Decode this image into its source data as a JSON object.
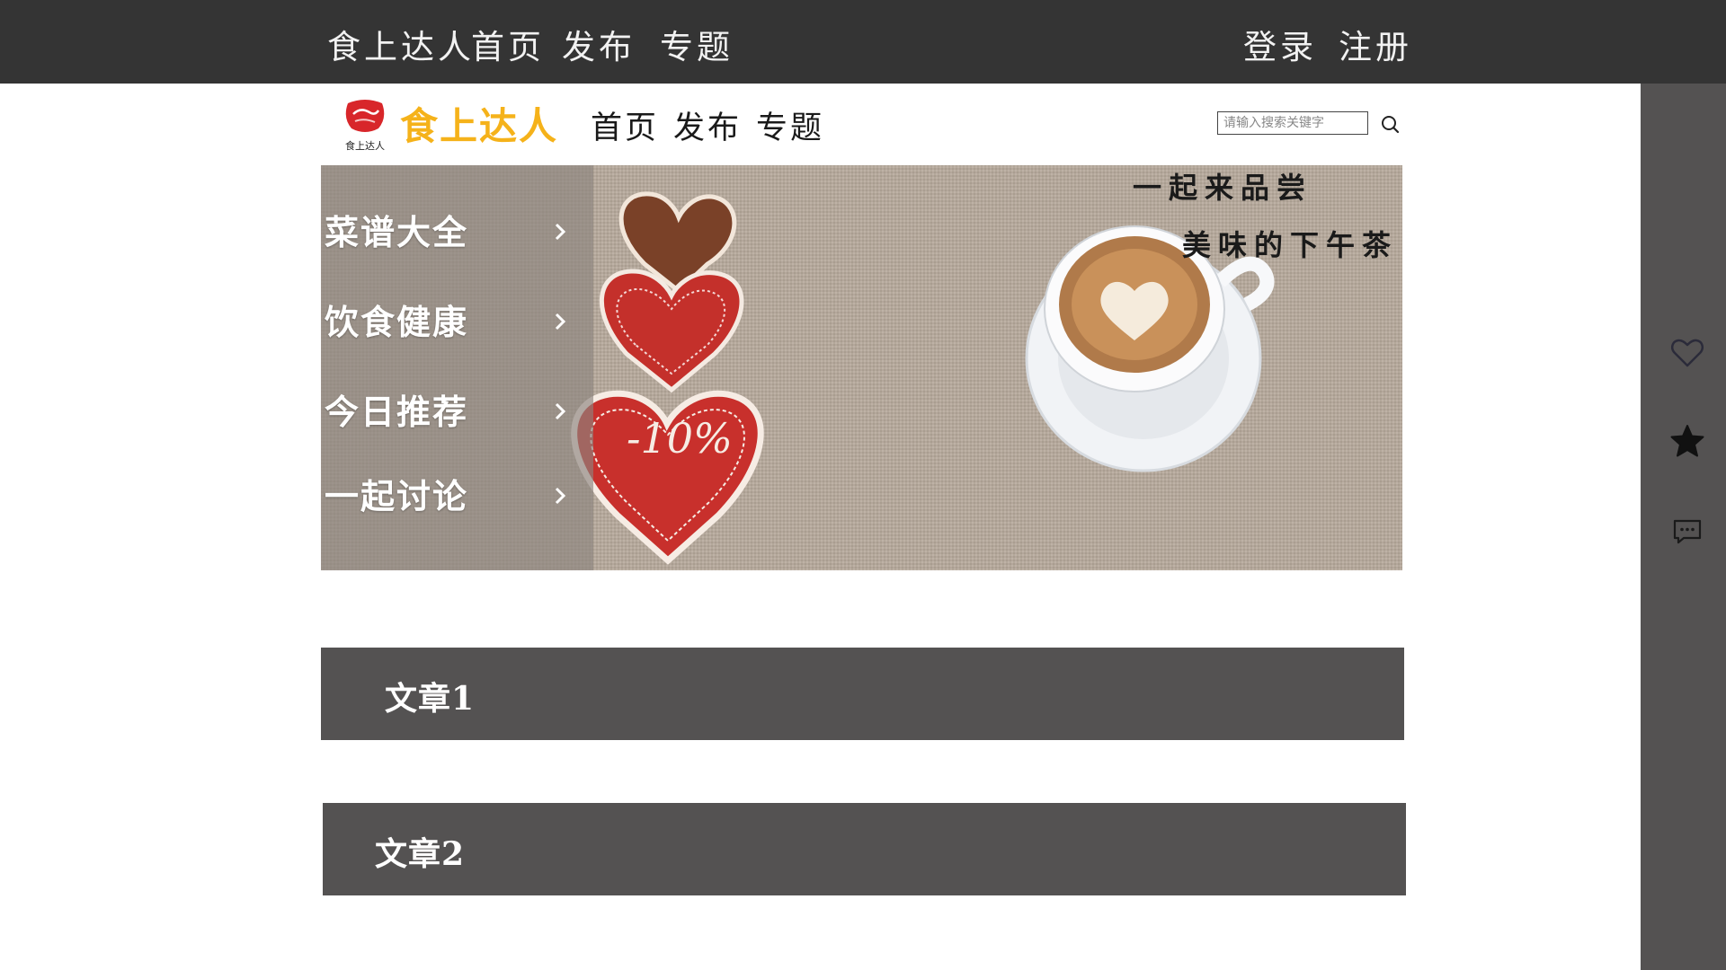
{
  "topbar": {
    "brand": "食上达人",
    "nav": [
      "首页",
      "发布",
      "专题"
    ],
    "login": "登录",
    "register": "注册"
  },
  "header": {
    "logo_caption": "食上达人",
    "brand": "食上达人",
    "nav": [
      "首页",
      "发布",
      "专题"
    ],
    "search_placeholder": "请输入搜索关键字"
  },
  "banner": {
    "menu": [
      "菜谱大全",
      "饮食健康",
      "今日推荐",
      "一起讨论"
    ],
    "headline_1": "一起来品尝",
    "headline_2": "美味的下午茶",
    "badge": "-10%"
  },
  "articles": [
    "文章1",
    "文章2"
  ],
  "sidebar": {
    "icons": [
      "heart-icon",
      "star-icon",
      "comment-icon"
    ]
  },
  "colors": {
    "topbar": "#343434",
    "sidebar": "#545252",
    "article_bg": "#545252",
    "brand": "#f5b21a"
  }
}
